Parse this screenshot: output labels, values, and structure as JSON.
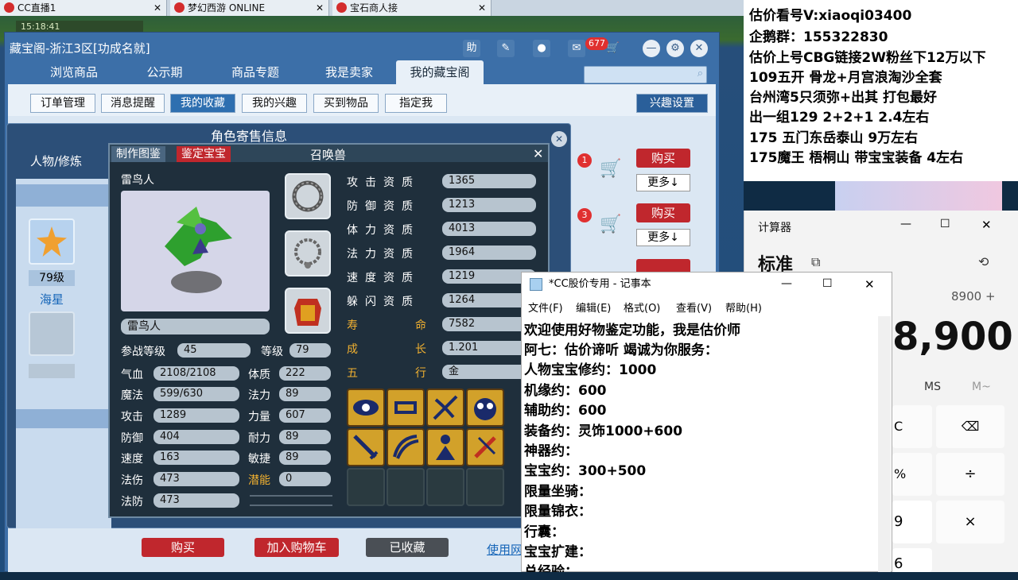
{
  "browser_tabs": [
    {
      "label": "CC直播1"
    },
    {
      "label": "梦幻西游 ONLINE"
    },
    {
      "label": "宝石商人接"
    }
  ],
  "game_time": "15:18:41",
  "panel": {
    "title": "藏宝阁-浙江3区[功成名就]",
    "help": "助",
    "notify_count": "677",
    "nav_tabs": [
      "浏览商品",
      "公示期",
      "商品专题",
      "我是卖家",
      "我的藏宝阁"
    ],
    "sub_tabs": [
      "订单管理",
      "消息提醒",
      "我的收藏",
      "我的兴趣",
      "买到物品",
      "指定我"
    ],
    "interest_settings": "兴趣设置",
    "buy": "购买",
    "more": "更多↓",
    "badge1": "1",
    "badge2": "3"
  },
  "charwin": {
    "title": "角色寄售信息",
    "left_tab": "人物/修炼",
    "pet_level": "79级",
    "pet_name_left": "海星"
  },
  "summon": {
    "tab1": "制作图鉴",
    "tab2": "鉴定宝宝",
    "title": "召唤兽",
    "name": "雷鸟人",
    "name_box": "雷鸟人",
    "battle_level_label": "参战等级",
    "battle_level": "45",
    "level_label": "等级",
    "level": "79",
    "stats": [
      {
        "label": "气血",
        "value": "2108/2108",
        "label2": "体质",
        "value2": "222"
      },
      {
        "label": "魔法",
        "value": "599/630",
        "label2": "法力",
        "value2": "89"
      },
      {
        "label": "攻击",
        "value": "1289",
        "label2": "力量",
        "value2": "607"
      },
      {
        "label": "防御",
        "value": "404",
        "label2": "耐力",
        "value2": "89"
      },
      {
        "label": "速度",
        "value": "163",
        "label2": "敏捷",
        "value2": "89"
      },
      {
        "label": "法伤",
        "value": "473",
        "label2": "潜能",
        "value2": "0"
      },
      {
        "label": "法防",
        "value": "473"
      }
    ],
    "aptitudes": [
      {
        "label": "攻击资质",
        "value": "1365"
      },
      {
        "label": "防御资质",
        "value": "1213"
      },
      {
        "label": "体力资质",
        "value": "4013"
      },
      {
        "label": "法力资质",
        "value": "1964"
      },
      {
        "label": "速度资质",
        "value": "1219"
      },
      {
        "label": "躲闪资质",
        "value": "1264"
      },
      {
        "label": "寿命",
        "value": "7582"
      },
      {
        "label": "成长",
        "value": "1.201"
      },
      {
        "label": "五行",
        "value": "金"
      }
    ]
  },
  "bottom_buttons": {
    "buy": "购买",
    "cart": "加入购物车",
    "collected": "已收藏",
    "link": "使用网"
  },
  "right_text": [
    "估价看号V:xiaoqi03400",
    "企鹅群：155322830",
    "估价上号CBG链接2W粉丝下12万以下",
    "109五开 骨龙+月宫浪淘沙全套",
    "台州湾5只须弥+出其 打包最好",
    "出一组129 2+2+1   2.4左右",
    "175 五门东岳泰山  9万左右",
    "175魔王 梧桐山  带宝宝装备 4左右"
  ],
  "calculator": {
    "title": "计算器",
    "mode": "标准",
    "history": "8900 +",
    "display": "8,900",
    "ms": "MS",
    "mplus": "M~",
    "keys": [
      "C",
      "⌫",
      "%",
      "÷",
      "9",
      "×",
      "6"
    ]
  },
  "notepad": {
    "title": "*CC股价专用 - 记事本",
    "menu": [
      "文件(F)",
      "编辑(E)",
      "格式(O)",
      "查看(V)",
      "帮助(H)"
    ],
    "lines": [
      "欢迎使用好物鉴定功能，我是估价师",
      "阿七：估价谛听 竭诚为你服务：",
      "人物宝宝修约：1000",
      "机缘约：600",
      "辅助约：600",
      "装备约：灵饰1000+600",
      "神器约：",
      "宝宝约：300+500",
      "限量坐骑：",
      "限量锦衣：",
      "行囊：",
      "宝宝扩建：",
      "总经验："
    ]
  },
  "colors": {
    "accent": "#2e6fb0",
    "buy_red": "#c0272d",
    "gold": "#f0b030"
  }
}
